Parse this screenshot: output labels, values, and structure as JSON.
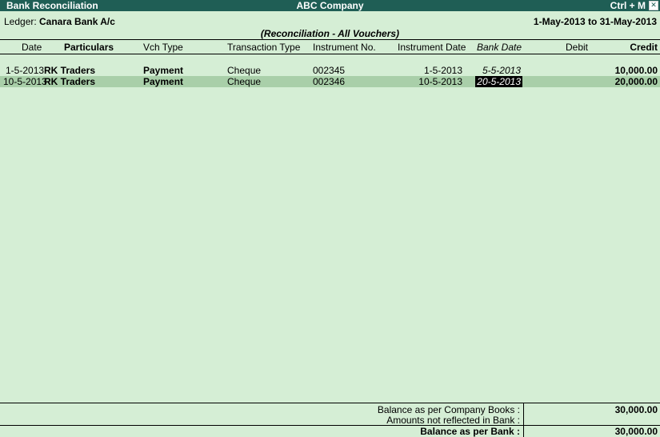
{
  "titlebar": {
    "left": "Bank Reconciliation",
    "center": "ABC Company",
    "shortcut": "Ctrl + M",
    "close_glyph": "✕"
  },
  "ledger": {
    "label": "Ledger:",
    "name": "Canara Bank A/c",
    "period": "1-May-2013 to 31-May-2013"
  },
  "columns": {
    "date": "Date",
    "particulars": "Particulars",
    "vch_type": "Vch Type",
    "transaction_type": "Transaction Type",
    "instrument_no": "Instrument No.",
    "instrument_date": "Instrument Date",
    "bank_date": "Bank Date",
    "debit": "Debit",
    "credit": "Credit"
  },
  "subtitle": "(Reconciliation - All Vouchers)",
  "rows": [
    {
      "date": "1-5-2013",
      "particulars": "RK Traders",
      "vch_type": "Payment",
      "transaction_type": "Cheque",
      "instrument_no": "002345",
      "instrument_date": "1-5-2013",
      "bank_date": "5-5-2013",
      "debit": "",
      "credit": "10,000.00"
    },
    {
      "date": "10-5-2013",
      "particulars": "RK Traders",
      "vch_type": "Payment",
      "transaction_type": "Cheque",
      "instrument_no": "002346",
      "instrument_date": "10-5-2013",
      "bank_date": "20-5-2013",
      "debit": "",
      "credit": "20,000.00"
    }
  ],
  "footer": {
    "books_label": "Balance as per Company Books :",
    "books_value": "30,000.00",
    "not_reflected_label": "Amounts not reflected in Bank :",
    "bank_label": "Balance as per Bank :",
    "bank_value": "30,000.00"
  },
  "colors": {
    "background": "#d5eed5",
    "titlebar": "#1f5e55",
    "selected_row": "#a9cfa9"
  }
}
